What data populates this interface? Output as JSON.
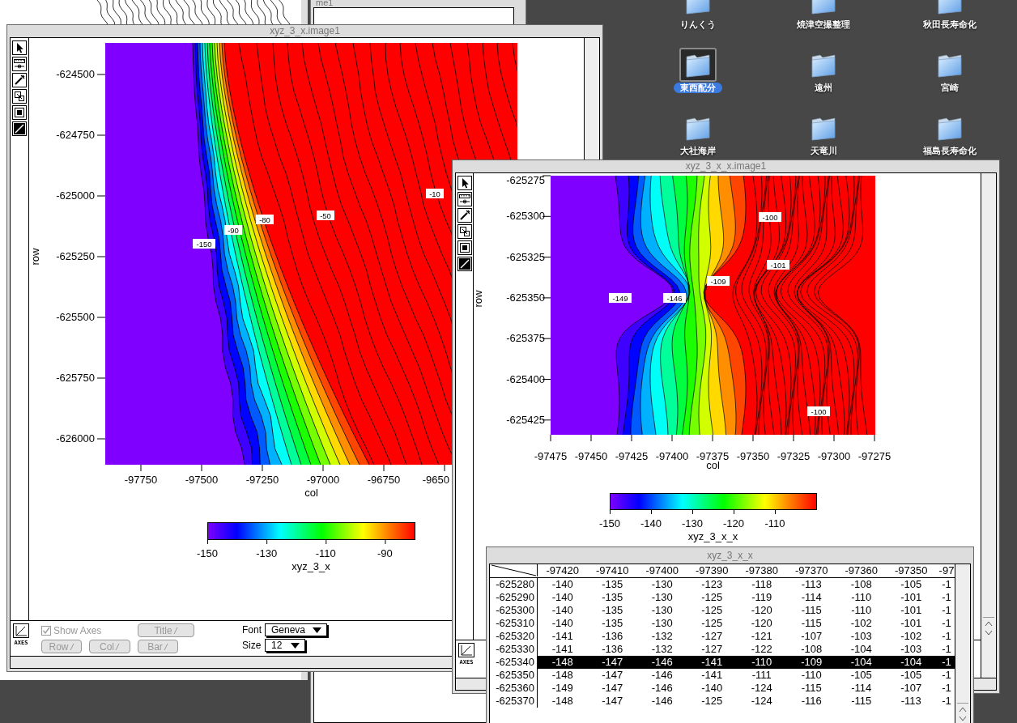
{
  "background_windows": [
    {
      "title": "me1"
    }
  ],
  "desktop_icons": [
    {
      "label": "りんくう",
      "selected": false
    },
    {
      "label": "焼津空撮整理",
      "selected": false
    },
    {
      "label": "秋田長寿命化",
      "selected": false
    },
    {
      "label": "東西配分",
      "selected": true
    },
    {
      "label": "遠州",
      "selected": false
    },
    {
      "label": "宮崎",
      "selected": false
    },
    {
      "label": "大社海岸",
      "selected": false
    },
    {
      "label": "天竜川",
      "selected": false
    },
    {
      "label": "福島長寿命化",
      "selected": false
    }
  ],
  "plot_windows": [
    {
      "title": "xyz_3_x.image1",
      "kind": "shore",
      "y_label": "row",
      "x_label": "col",
      "y_ticks": [
        "-624500",
        "-624750",
        "-625000",
        "-625250",
        "-625500",
        "-625750",
        "-626000"
      ],
      "x_ticks": [
        "-97750",
        "-97500",
        "-97250",
        "-97000",
        "-96750",
        "-9650"
      ],
      "contour_labels": [
        "-10",
        "-80",
        "-50",
        "-90",
        "-150"
      ],
      "colorbar": {
        "ticks": [
          "-150",
          "-130",
          "-110",
          "-90"
        ],
        "label": "xyz_3_x"
      },
      "axes_button": "AXES",
      "controls": {
        "show_axes": {
          "label": "Show Axes",
          "checked": true,
          "disabled": true
        },
        "buttons": [
          {
            "label": "Title",
            "disabled": true
          },
          {
            "label": "Row",
            "disabled": true
          },
          {
            "label": "Col",
            "disabled": true
          },
          {
            "label": "Bar",
            "disabled": true
          }
        ],
        "font": {
          "label": "Font",
          "value": "Geneva"
        },
        "size": {
          "label": "Size",
          "value": "12"
        }
      }
    },
    {
      "title": "xyz_3_x_x.image1",
      "kind": "saddle",
      "y_label": "row",
      "x_label": "col",
      "y_ticks": [
        "-625275",
        "-625300",
        "-625325",
        "-625350",
        "-625375",
        "-625400",
        "-625425"
      ],
      "x_ticks": [
        "-97475",
        "-97450",
        "-97425",
        "-97400",
        "-97375",
        "-97350",
        "-97325",
        "-97300",
        "-97275"
      ],
      "contour_labels": [
        "-100",
        "-101",
        "-109",
        "-149",
        "-146",
        "-100"
      ],
      "colorbar": {
        "ticks": [
          "-150",
          "-140",
          "-130",
          "-120",
          "-110"
        ],
        "label": "xyz_3_x_x"
      },
      "axes_button": "AXES"
    }
  ],
  "table_window": {
    "title": "xyz_3_x_x",
    "columns": [
      "-97420",
      "-97410",
      "-97400",
      "-97390",
      "-97380",
      "-97370",
      "-97360",
      "-97350",
      "-97"
    ],
    "rows": [
      {
        "header": "-625280",
        "selected": false,
        "cells": [
          "-140",
          "-135",
          "-130",
          "-123",
          "-118",
          "-113",
          "-108",
          "-105",
          "-1"
        ]
      },
      {
        "header": "-625290",
        "selected": false,
        "cells": [
          "-140",
          "-135",
          "-130",
          "-125",
          "-119",
          "-114",
          "-110",
          "-101",
          "-1"
        ]
      },
      {
        "header": "-625300",
        "selected": false,
        "cells": [
          "-140",
          "-135",
          "-130",
          "-125",
          "-120",
          "-115",
          "-110",
          "-101",
          "-1"
        ]
      },
      {
        "header": "-625310",
        "selected": false,
        "cells": [
          "-140",
          "-135",
          "-130",
          "-125",
          "-120",
          "-115",
          "-102",
          "-101",
          "-1"
        ]
      },
      {
        "header": "-625320",
        "selected": false,
        "cells": [
          "-141",
          "-136",
          "-132",
          "-127",
          "-121",
          "-107",
          "-103",
          "-102",
          "-1"
        ]
      },
      {
        "header": "-625330",
        "selected": false,
        "cells": [
          "-141",
          "-136",
          "-132",
          "-127",
          "-122",
          "-108",
          "-104",
          "-103",
          "-1"
        ]
      },
      {
        "header": "-625340",
        "selected": true,
        "cells": [
          "-148",
          "-147",
          "-146",
          "-141",
          "-110",
          "-109",
          "-104",
          "-104",
          "-1"
        ]
      },
      {
        "header": "-625350",
        "selected": false,
        "cells": [
          "-148",
          "-147",
          "-146",
          "-141",
          "-111",
          "-110",
          "-105",
          "-105",
          "-1"
        ]
      },
      {
        "header": "-625360",
        "selected": false,
        "cells": [
          "-149",
          "-147",
          "-146",
          "-140",
          "-124",
          "-115",
          "-114",
          "-107",
          "-1"
        ]
      },
      {
        "header": "-625370",
        "selected": false,
        "cells": [
          "-148",
          "-147",
          "-146",
          "-125",
          "-124",
          "-116",
          "-115",
          "-113",
          "-1"
        ]
      }
    ]
  }
}
